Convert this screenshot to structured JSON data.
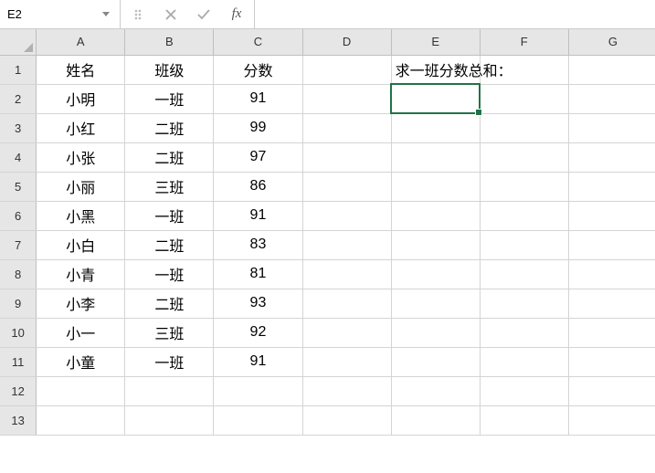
{
  "formula_bar": {
    "name_box": "E2",
    "formula_value": ""
  },
  "columns": [
    "A",
    "B",
    "C",
    "D",
    "E",
    "F",
    "G"
  ],
  "row_count": 13,
  "active_cell": {
    "row": 2,
    "col": "E"
  },
  "headers": {
    "A": "姓名",
    "B": "班级",
    "C": "分数"
  },
  "note_cell": {
    "row": 1,
    "col": "E",
    "text": "求一班分数总和："
  },
  "rows": [
    {
      "A": "小明",
      "B": "一班",
      "C": "91"
    },
    {
      "A": "小红",
      "B": "二班",
      "C": "99"
    },
    {
      "A": "小张",
      "B": "二班",
      "C": "97"
    },
    {
      "A": "小丽",
      "B": "三班",
      "C": "86"
    },
    {
      "A": "小黑",
      "B": "一班",
      "C": "91"
    },
    {
      "A": "小白",
      "B": "二班",
      "C": "83"
    },
    {
      "A": "小青",
      "B": "一班",
      "C": "81"
    },
    {
      "A": "小李",
      "B": "二班",
      "C": "93"
    },
    {
      "A": "小一",
      "B": "三班",
      "C": "92"
    },
    {
      "A": "小童",
      "B": "一班",
      "C": "91"
    }
  ]
}
